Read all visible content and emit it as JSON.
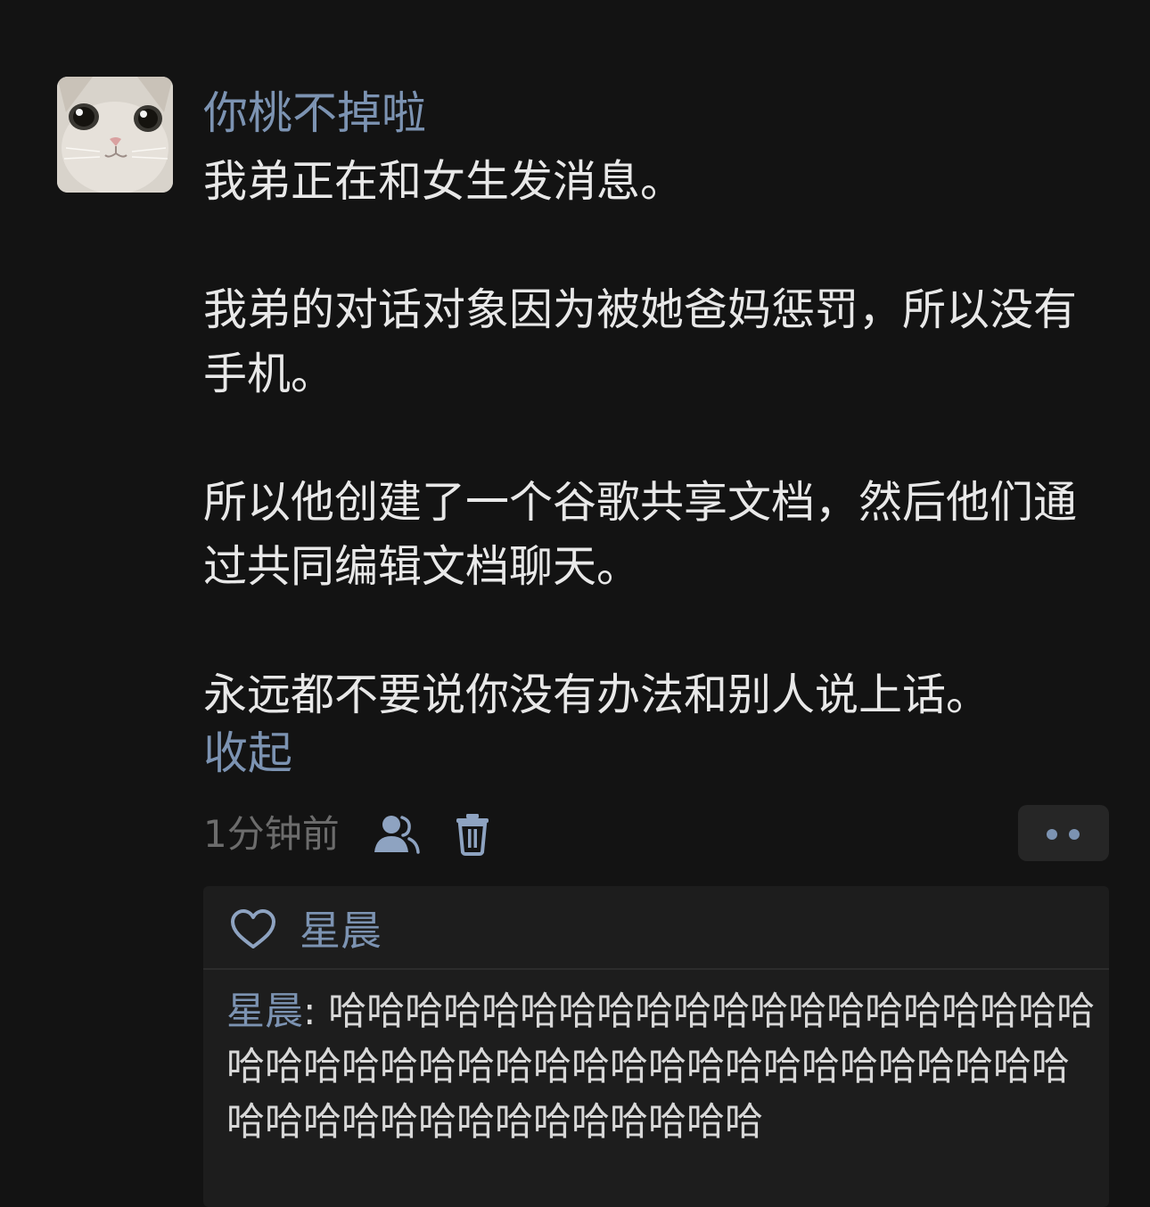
{
  "post": {
    "author": "你桃不掉啦",
    "paragraphs": [
      "我弟正在和女生发消息。",
      "我弟的对话对象因为被她爸妈惩罚，所以没有手机。",
      "所以他创建了一个谷歌共享文档，然后他们通过共同编辑文档聊天。",
      "永远都不要说你没有办法和别人说上话。"
    ],
    "collapse_label": "收起",
    "time": "1分钟前",
    "icons": {
      "visibility": "people-visibility-icon",
      "delete": "trash-icon",
      "more": "more-dots-icon",
      "like": "heart-icon"
    }
  },
  "likes": {
    "names": "星晨"
  },
  "comment": {
    "author": "星晨",
    "separator": ": ",
    "text": "哈哈哈哈哈哈哈哈哈哈哈哈哈哈哈哈哈哈哈哈哈哈哈哈哈哈哈哈哈哈哈哈哈哈哈哈哈哈哈哈哈哈哈哈哈哈哈哈哈哈哈哈哈哈哈哈"
  },
  "colors": {
    "background": "#131313",
    "link_blue": "#7c93b2",
    "body_text": "#e8e8e8",
    "muted": "#6c6c6c",
    "reply_panel": "#1d1d1d"
  }
}
